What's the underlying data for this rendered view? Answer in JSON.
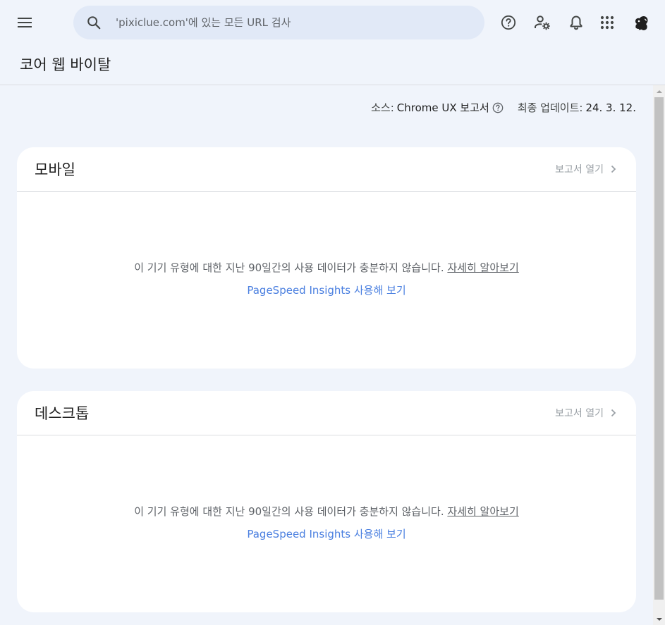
{
  "topbar": {
    "search_placeholder": "'pixiclue.com'에 있는 모든 URL 검사",
    "icons": [
      "menu-icon",
      "search-icon",
      "help-icon",
      "manage-accounts-icon",
      "notifications-icon",
      "apps-icon",
      "avatar"
    ]
  },
  "page": {
    "title": "코어 웹 바이탈"
  },
  "meta": {
    "source_label": "소스:",
    "source_value": "Chrome UX 보고서",
    "updated_label": "최종 업데이트:",
    "updated_value": "24. 3. 12."
  },
  "cards": [
    {
      "title": "모바일",
      "open_report": "보고서 열기",
      "message": "이 기기 유형에 대한 지난 90일간의 사용 데이터가 충분하지 않습니다.",
      "learn_more": "자세히 알아보기",
      "psi_link": "PageSpeed Insights 사용해 보기"
    },
    {
      "title": "데스크톱",
      "open_report": "보고서 열기",
      "message": "이 기기 유형에 대한 지난 90일간의 사용 데이터가 충분하지 않습니다.",
      "learn_more": "자세히 알아보기",
      "psi_link": "PageSpeed Insights 사용해 보기"
    }
  ],
  "colors": {
    "background": "#f0f4fb",
    "search_bg": "#e1e9f7",
    "card_bg": "#ffffff",
    "link_blue": "#4a7fe0",
    "muted_text": "#5f6368"
  }
}
